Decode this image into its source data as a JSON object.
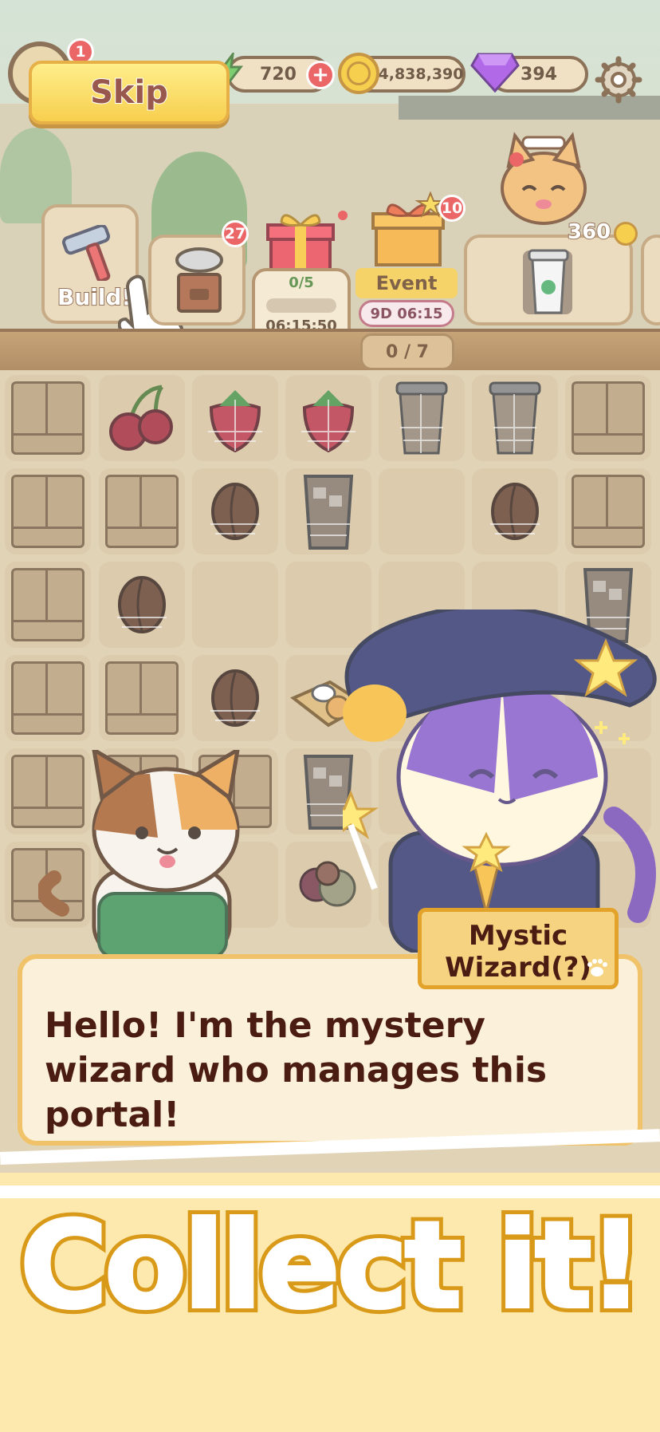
{
  "hud": {
    "level_badge": "1",
    "energy": "720",
    "coins": "4,838,390",
    "gems": "394",
    "skip_label": "Skip"
  },
  "quests": {
    "build_label": "Build!",
    "grinder_badge": "27",
    "chest_progress": "0/5",
    "chest_timer": "06:15:50",
    "event_badge": "10",
    "event_label": "Event",
    "event_timer": "9D 06:15",
    "event_progress": "0 / 7",
    "order_price": "360"
  },
  "dialog": {
    "speaker": "Mystic Wizard(?)",
    "text": "Hello! I'm the mystery wizard who manages this portal!"
  },
  "banner": {
    "headline": "Collect it!"
  },
  "colors": {
    "accent_yellow": "#f5c21d",
    "banner_bg": "#fde8ae",
    "text_dark": "#4a1c12",
    "badge_red": "#e63b3b"
  }
}
